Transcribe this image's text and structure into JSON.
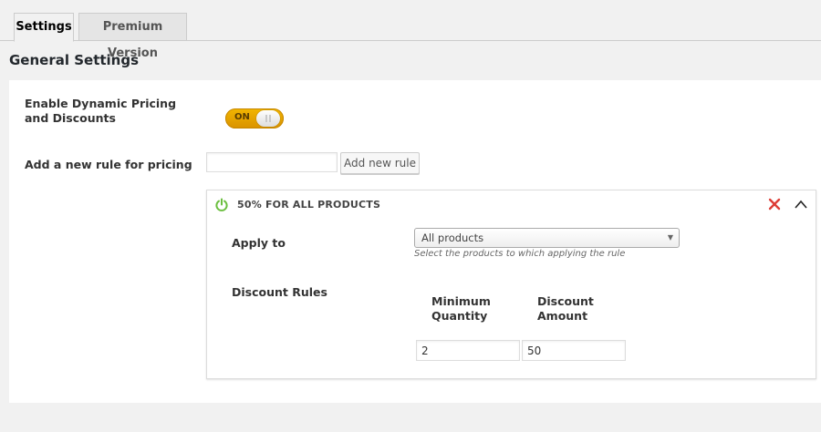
{
  "tabs": [
    {
      "label": "Settings",
      "active": true
    },
    {
      "label": "Premium Version",
      "active": false
    }
  ],
  "section_title": "General Settings",
  "settings": {
    "enable_label": "Enable Dynamic Pricing and Discounts",
    "toggle_state": "ON",
    "add_rule_label": "Add a new rule for pricing",
    "add_rule_input_value": "",
    "add_rule_button": "Add new rule"
  },
  "rule": {
    "title": "50% FOR ALL PRODUCTS",
    "apply_to_label": "Apply to",
    "apply_to_value": "All products",
    "apply_to_hint": "Select the products to which applying the rule",
    "discount_rules_label": "Discount Rules",
    "columns": [
      "Minimum Quantity",
      "Discount Amount"
    ],
    "rows": [
      {
        "min_quantity": "2",
        "discount_amount": "50"
      }
    ]
  },
  "colors": {
    "toggle_on": "#f0ad00",
    "power_icon": "#6bbf3f",
    "delete_icon": "#dd3d36"
  },
  "icons": {
    "power": "power-icon",
    "delete": "close-icon",
    "collapse": "chevron-up-icon",
    "select": "triangle-down-icon"
  }
}
